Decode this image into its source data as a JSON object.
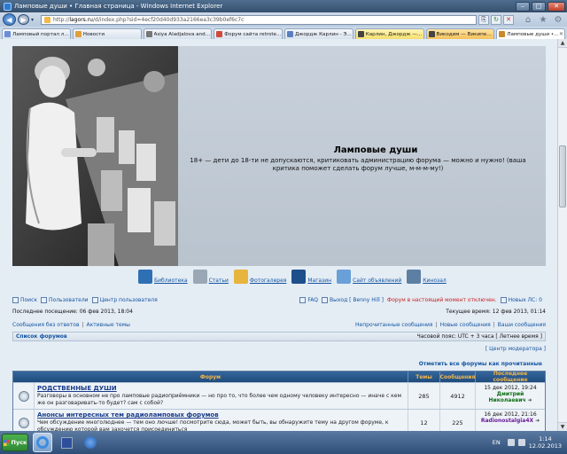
{
  "window": {
    "title": "Ламповые души • Главная страница - Windows Internet Explorer",
    "minimize_label": "–",
    "maximize_label": "□",
    "close_label": "✕"
  },
  "address": {
    "back_glyph": "◀",
    "forward_glyph": "▶",
    "url_prefix": "http://",
    "url_domain": "lagors.ru",
    "url_rest": "/d/index.php?sid=4ecf20d40d933a2166ea3c39b0ef6c7c",
    "compat_glyph": "⎘",
    "refresh_glyph": "↻",
    "stop_glyph": "✕",
    "home_glyph": "⌂",
    "fav_glyph": "★",
    "tools_glyph": "⚙"
  },
  "tabs": [
    {
      "label": "Ламповый портал лю...",
      "color": "#6b8fd6"
    },
    {
      "label": "Новости",
      "color": "#e0a03a"
    },
    {
      "label": "Asiya Aladjalova and V...",
      "color": "#777777"
    },
    {
      "label": "Форум сайта retrotex...",
      "color": "#d04a3a"
    },
    {
      "label": "Джордж Карлин - Эт...",
      "color": "#5a7fbf"
    },
    {
      "label": "Карлин, Джордж — В...",
      "color": "#444444"
    },
    {
      "label": "Викодим — Википедия",
      "color": "#444444"
    },
    {
      "label": "Ламповые души • ...",
      "color": "#c88a2a"
    }
  ],
  "header": {
    "site_title": "Ламповые души",
    "site_description": "18+ — дети до 18-ти не допускаются, критиковать администрацию форума — можно и нужно! (ваша критика поможет сделать форум лучше, м-м-м-му!)"
  },
  "nav_icons": [
    {
      "label": "Библиотека",
      "color": "#2f6fb3"
    },
    {
      "label": "Статьи",
      "color": "#9aa7b5"
    },
    {
      "label": "Фотогалерея",
      "color": "#e7b43d"
    },
    {
      "label": "Магазин",
      "color": "#1d4f8a"
    },
    {
      "label": "Сайт объявлений",
      "color": "#6aa0d8"
    },
    {
      "label": "Кинозал",
      "color": "#5d7fa3"
    }
  ],
  "toplinks": {
    "search": "Поиск",
    "users": "Пользователи",
    "ucp": "Центр пользователя",
    "faq": "FAQ",
    "logout": "Выход [ Benny Hill ]",
    "offline": "Форум в настоящий момент отключен.",
    "pm": "Новых ЛС: 0"
  },
  "lastvisit": {
    "left": "Последнее посещение: 06 фев 2013, 18:04",
    "right": "Текущее время: 12 фев 2013, 01:14"
  },
  "quicklinks": {
    "unanswered": "Сообщения без ответов",
    "sep": "|",
    "active": "Активные темы",
    "unread": "Непрочитанные сообщения",
    "new": "Новые сообщения",
    "yours": "Ваши сообщения"
  },
  "breadcrumb": {
    "crumb": "Список форумов",
    "timezone": "Часовой пояс: UTC + 3 часа [ Летнее время ]"
  },
  "mod": {
    "link": "[ Центр модератора ]",
    "markread": "Отметить все форумы как прочитанные"
  },
  "table": {
    "headers": {
      "forum": "Форум",
      "topics": "Темы",
      "posts": "Сообщения",
      "last": "Последнее сообщение"
    },
    "rows": [
      {
        "name": "РОДСТВЕННЫЕ ДУШИ",
        "desc": "Разговоры в основном не про ламповые радиоприёмники — но про то, что более чем одному человеку интересно — иначе с кем же он разговаривать-то будет? сам с собой?",
        "topics": "285",
        "posts": "4912",
        "date": "15 дек 2012, 19:24",
        "user": "Дмитрий Николаевич",
        "arrow": "➜"
      },
      {
        "name": "Анонсы интересных тем радиоламповых форумов",
        "desc": "Чем обсуждение многолюднее — тем оно лючше! посмотрите сюда, может быть, вы обнаружите тему на другом форуме, к обсуждению которой вам захочется присоединиться",
        "topics": "12",
        "posts": "225",
        "date": "16 дек 2012, 21:16",
        "user": "Radionostalgia4X",
        "arrow": "➜"
      }
    ]
  },
  "scrollbar": {
    "up": "▲",
    "down": "▼"
  },
  "taskbar": {
    "start": "Пуск",
    "lang": "EN",
    "time": "1:14",
    "date": "12.02.2013"
  }
}
